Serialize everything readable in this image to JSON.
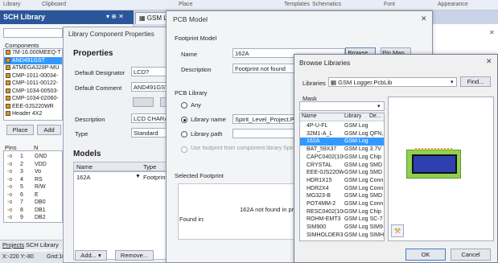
{
  "ribbon": {
    "library": "Library",
    "clipboard": "Clipboard",
    "place": "Place",
    "templates": "Templates",
    "schematics": "Schematics",
    "font": "Font",
    "appearance": "Appearance"
  },
  "sch_panel": {
    "title": "SCH Library",
    "components_label": "Components",
    "components": [
      "7M-16.000MEEQ-T",
      "AND491GST",
      "ATMEGA328P-MU",
      "CMP-1011-00034-",
      "CMP-1011-00122-",
      "CMP-1034-00503-",
      "CMP-1034-02060-",
      "EEE-0JS220WR",
      "Header 4X2"
    ],
    "place_btn": "Place",
    "add_btn": "Add",
    "pins_label": "Pins",
    "pin_col2": "N",
    "pins": [
      {
        "num": "1",
        "name": "GND"
      },
      {
        "num": "2",
        "name": "VDD"
      },
      {
        "num": "3",
        "name": "Vo"
      },
      {
        "num": "4",
        "name": "RS"
      },
      {
        "num": "5",
        "name": "R/W"
      },
      {
        "num": "6",
        "name": "E"
      },
      {
        "num": "7",
        "name": "DB0"
      },
      {
        "num": "8",
        "name": "DB1"
      },
      {
        "num": "9",
        "name": "DB2"
      }
    ],
    "tab_projects": "Projects",
    "tab_sch": "SCH Library",
    "status_pos": "X:-220 Y:-80",
    "status_grid": "Grid:10"
  },
  "lcp": {
    "title": "Library Component Properties",
    "properties": "Properties",
    "default_designator_label": "Default Designator",
    "default_designator_value": "LCD?",
    "default_comment_label": "Default Comment",
    "default_comment_value": "AND491GST",
    "description_label": "Description",
    "description_value": "LCD CHARACT",
    "type_label": "Type",
    "type_value": "Standard",
    "models": "Models",
    "col_name": "Name",
    "col_type": "Type",
    "model_name": "162A",
    "model_type": "Footprint",
    "add_btn": "Add...",
    "remove_btn": "Remove..."
  },
  "pcb": {
    "title": "PCB Model",
    "footprint_model": "Footprint Model",
    "name_label": "Name",
    "name_value": "162A",
    "browse_btn": "Browse...",
    "pinmap_btn": "Pin Map...",
    "description_label": "Description",
    "description_value": "Footprint not found",
    "pcb_library": "PCB Library",
    "any": "Any",
    "library_name": "Library name",
    "library_name_value": "Spirit_Level_Project.PcbLib",
    "library_path": "Library path",
    "use_footprint": "Use footprint from component library SpiritLevel",
    "selected_footprint": "Selected Footprint",
    "not_found": "162A not found in project",
    "found_in": "Found in:"
  },
  "browse": {
    "title": "Browse Libraries",
    "libraries_label": "Libraries",
    "libraries_value": "GSM Logger.PcbLib",
    "find_btn": "Find...",
    "mask_label": "Mask",
    "col_name": "Name",
    "col_library": "Library",
    "col_desc": "De...",
    "rows": [
      {
        "name": "4P-U-FL",
        "lib": "GSM Log"
      },
      {
        "name": "32M1-A_L",
        "lib": "GSM Log QFN,"
      },
      {
        "name": "162A",
        "lib": "GSM Log"
      },
      {
        "name": "BAT_59X37",
        "lib": "GSM Log 3.7V"
      },
      {
        "name": "CAPC0402(1005",
        "lib": "GSM Log Chip"
      },
      {
        "name": "CRYSTAL",
        "lib": "GSM Log SMD"
      },
      {
        "name": "EEE-0JS220WR",
        "lib": "GSM Log SMD"
      },
      {
        "name": "HDR1X15",
        "lib": "GSM Log Conn"
      },
      {
        "name": "HDR2X4",
        "lib": "GSM Log Conn"
      },
      {
        "name": "MG323-B",
        "lib": "GSM Log SMD"
      },
      {
        "name": "POT4MM-2",
        "lib": "GSM Log Conn"
      },
      {
        "name": "RESC0402(1005",
        "lib": "GSM Log Chip"
      },
      {
        "name": "ROHM-EMT3",
        "lib": "GSM Log SC-7"
      },
      {
        "name": "SIM900",
        "lib": "GSM Log SIM9"
      },
      {
        "name": "SIMHOLDER3",
        "lib": "GSM Log SIMH"
      }
    ],
    "ok_btn": "OK",
    "cancel_btn": "Cancel"
  },
  "colors": {
    "accent": "#2b579a",
    "selection": "#3399ff",
    "lcd_green": "#8fd14f",
    "lcd_blue": "#2e3fb0"
  }
}
